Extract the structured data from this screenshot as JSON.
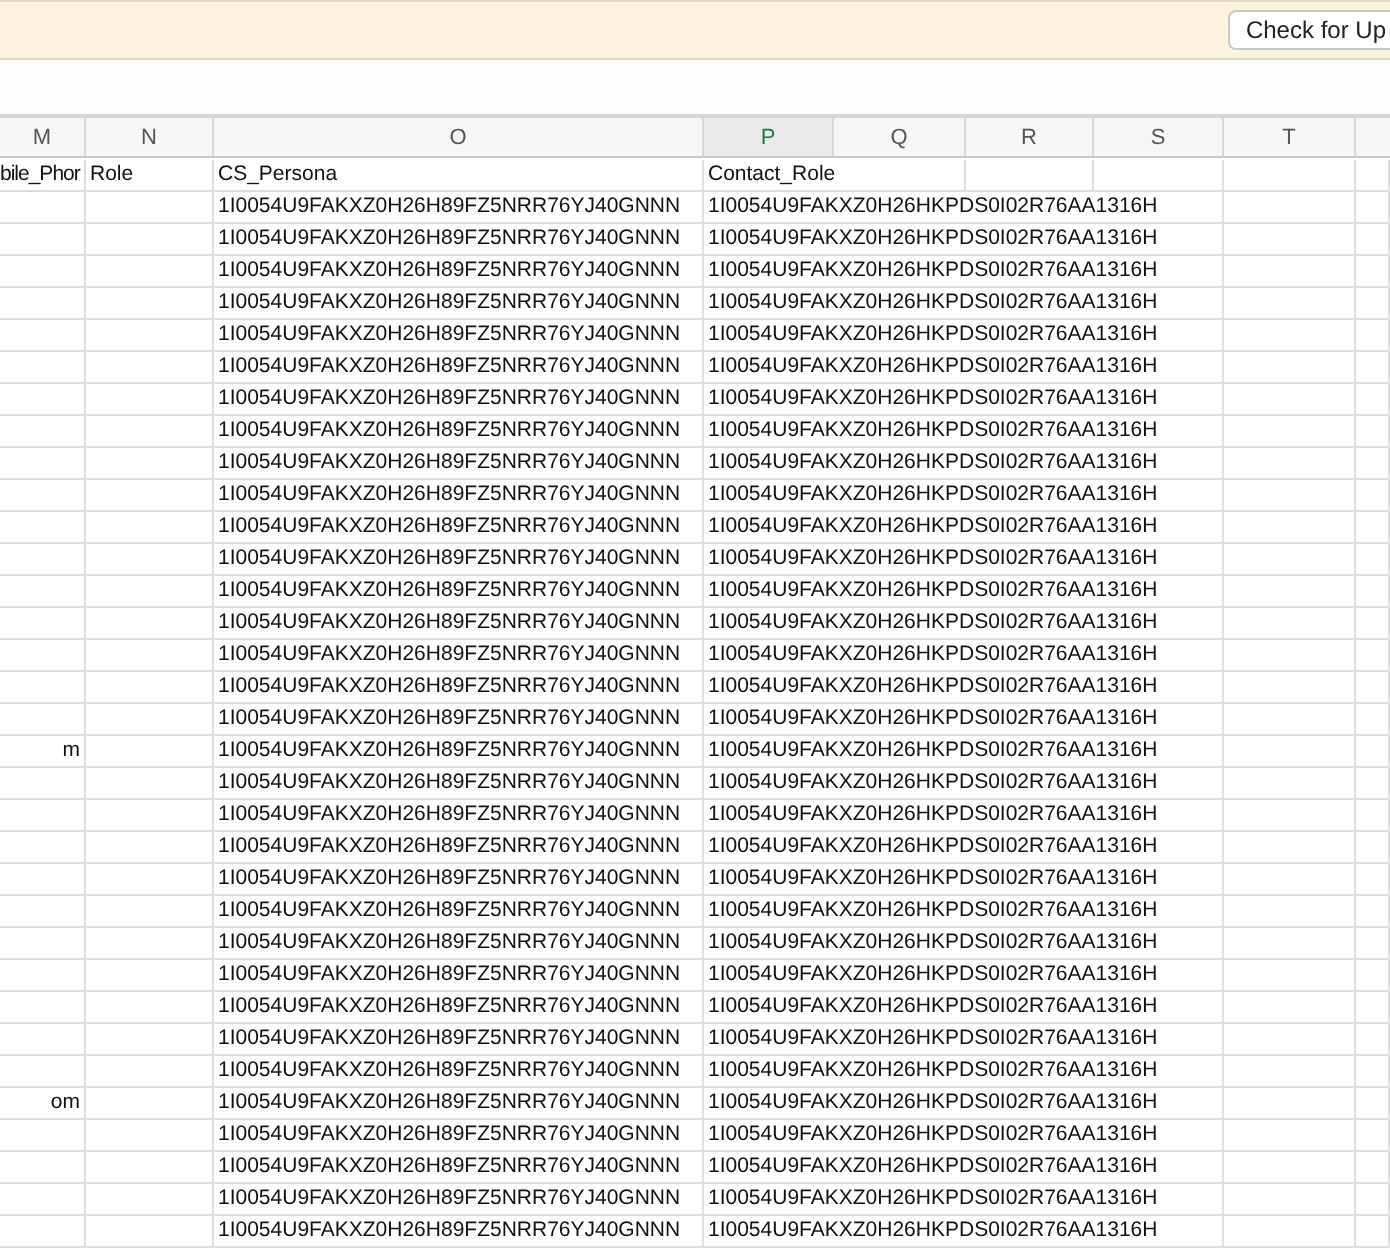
{
  "update_bar": {
    "button": "Check for Up"
  },
  "columns": [
    {
      "letter": "M",
      "selected": false
    },
    {
      "letter": "N",
      "selected": false
    },
    {
      "letter": "O",
      "selected": false
    },
    {
      "letter": "P",
      "selected": true
    },
    {
      "letter": "Q",
      "selected": false
    },
    {
      "letter": "R",
      "selected": false
    },
    {
      "letter": "S",
      "selected": false
    },
    {
      "letter": "T",
      "selected": false
    }
  ],
  "header_row": {
    "col_m": "bile_Phor",
    "col_n": "Role",
    "col_o": "CS_Persona",
    "col_p": "Contact_Role"
  },
  "rows": [
    {
      "col_o": "1I0054U9FAKXZ0H26H89FZ5NRR76YJ40GNNN",
      "col_p": "1I0054U9FAKXZ0H26HKPDS0I02R76AA1316H"
    },
    {
      "col_o": "1I0054U9FAKXZ0H26H89FZ5NRR76YJ40GNNN",
      "col_p": "1I0054U9FAKXZ0H26HKPDS0I02R76AA1316H"
    },
    {
      "col_o": "1I0054U9FAKXZ0H26H89FZ5NRR76YJ40GNNN",
      "col_p": "1I0054U9FAKXZ0H26HKPDS0I02R76AA1316H"
    },
    {
      "col_o": "1I0054U9FAKXZ0H26H89FZ5NRR76YJ40GNNN",
      "col_p": "1I0054U9FAKXZ0H26HKPDS0I02R76AA1316H"
    },
    {
      "col_o": "1I0054U9FAKXZ0H26H89FZ5NRR76YJ40GNNN",
      "col_p": "1I0054U9FAKXZ0H26HKPDS0I02R76AA1316H"
    },
    {
      "col_o": "1I0054U9FAKXZ0H26H89FZ5NRR76YJ40GNNN",
      "col_p": "1I0054U9FAKXZ0H26HKPDS0I02R76AA1316H"
    },
    {
      "col_o": "1I0054U9FAKXZ0H26H89FZ5NRR76YJ40GNNN",
      "col_p": "1I0054U9FAKXZ0H26HKPDS0I02R76AA1316H"
    },
    {
      "col_o": "1I0054U9FAKXZ0H26H89FZ5NRR76YJ40GNNN",
      "col_p": "1I0054U9FAKXZ0H26HKPDS0I02R76AA1316H"
    },
    {
      "col_o": "1I0054U9FAKXZ0H26H89FZ5NRR76YJ40GNNN",
      "col_p": "1I0054U9FAKXZ0H26HKPDS0I02R76AA1316H"
    },
    {
      "col_o": "1I0054U9FAKXZ0H26H89FZ5NRR76YJ40GNNN",
      "col_p": "1I0054U9FAKXZ0H26HKPDS0I02R76AA1316H"
    },
    {
      "col_o": "1I0054U9FAKXZ0H26H89FZ5NRR76YJ40GNNN",
      "col_p": "1I0054U9FAKXZ0H26HKPDS0I02R76AA1316H"
    },
    {
      "col_o": "1I0054U9FAKXZ0H26H89FZ5NRR76YJ40GNNN",
      "col_p": "1I0054U9FAKXZ0H26HKPDS0I02R76AA1316H"
    },
    {
      "col_o": "1I0054U9FAKXZ0H26H89FZ5NRR76YJ40GNNN",
      "col_p": "1I0054U9FAKXZ0H26HKPDS0I02R76AA1316H"
    },
    {
      "col_o": "1I0054U9FAKXZ0H26H89FZ5NRR76YJ40GNNN",
      "col_p": "1I0054U9FAKXZ0H26HKPDS0I02R76AA1316H"
    },
    {
      "col_o": "1I0054U9FAKXZ0H26H89FZ5NRR76YJ40GNNN",
      "col_p": "1I0054U9FAKXZ0H26HKPDS0I02R76AA1316H"
    },
    {
      "col_o": "1I0054U9FAKXZ0H26H89FZ5NRR76YJ40GNNN",
      "col_p": "1I0054U9FAKXZ0H26HKPDS0I02R76AA1316H"
    },
    {
      "col_o": "1I0054U9FAKXZ0H26H89FZ5NRR76YJ40GNNN",
      "col_p": "1I0054U9FAKXZ0H26HKPDS0I02R76AA1316H"
    },
    {
      "col_m": "m",
      "col_o": "1I0054U9FAKXZ0H26H89FZ5NRR76YJ40GNNN",
      "col_p": "1I0054U9FAKXZ0H26HKPDS0I02R76AA1316H"
    },
    {
      "col_o": "1I0054U9FAKXZ0H26H89FZ5NRR76YJ40GNNN",
      "col_p": "1I0054U9FAKXZ0H26HKPDS0I02R76AA1316H"
    },
    {
      "col_o": "1I0054U9FAKXZ0H26H89FZ5NRR76YJ40GNNN",
      "col_p": "1I0054U9FAKXZ0H26HKPDS0I02R76AA1316H"
    },
    {
      "col_o": "1I0054U9FAKXZ0H26H89FZ5NRR76YJ40GNNN",
      "col_p": "1I0054U9FAKXZ0H26HKPDS0I02R76AA1316H"
    },
    {
      "col_o": "1I0054U9FAKXZ0H26H89FZ5NRR76YJ40GNNN",
      "col_p": "1I0054U9FAKXZ0H26HKPDS0I02R76AA1316H"
    },
    {
      "col_o": "1I0054U9FAKXZ0H26H89FZ5NRR76YJ40GNNN",
      "col_p": "1I0054U9FAKXZ0H26HKPDS0I02R76AA1316H"
    },
    {
      "col_o": "1I0054U9FAKXZ0H26H89FZ5NRR76YJ40GNNN",
      "col_p": "1I0054U9FAKXZ0H26HKPDS0I02R76AA1316H"
    },
    {
      "col_o": "1I0054U9FAKXZ0H26H89FZ5NRR76YJ40GNNN",
      "col_p": "1I0054U9FAKXZ0H26HKPDS0I02R76AA1316H"
    },
    {
      "col_o": "1I0054U9FAKXZ0H26H89FZ5NRR76YJ40GNNN",
      "col_p": "1I0054U9FAKXZ0H26HKPDS0I02R76AA1316H"
    },
    {
      "col_o": "1I0054U9FAKXZ0H26H89FZ5NRR76YJ40GNNN",
      "col_p": "1I0054U9FAKXZ0H26HKPDS0I02R76AA1316H"
    },
    {
      "col_o": "1I0054U9FAKXZ0H26H89FZ5NRR76YJ40GNNN",
      "col_p": "1I0054U9FAKXZ0H26HKPDS0I02R76AA1316H"
    },
    {
      "col_m": "om",
      "col_o": "1I0054U9FAKXZ0H26H89FZ5NRR76YJ40GNNN",
      "col_p": "1I0054U9FAKXZ0H26HKPDS0I02R76AA1316H"
    },
    {
      "col_o": "1I0054U9FAKXZ0H26H89FZ5NRR76YJ40GNNN",
      "col_p": "1I0054U9FAKXZ0H26HKPDS0I02R76AA1316H"
    },
    {
      "col_o": "1I0054U9FAKXZ0H26H89FZ5NRR76YJ40GNNN",
      "col_p": "1I0054U9FAKXZ0H26HKPDS0I02R76AA1316H"
    },
    {
      "col_o": "1I0054U9FAKXZ0H26H89FZ5NRR76YJ40GNNN",
      "col_p": "1I0054U9FAKXZ0H26HKPDS0I02R76AA1316H"
    },
    {
      "col_o": "1I0054U9FAKXZ0H26H89FZ5NRR76YJ40GNNN",
      "col_p": "1I0054U9FAKXZ0H26HKPDS0I02R76AA1316H"
    }
  ]
}
